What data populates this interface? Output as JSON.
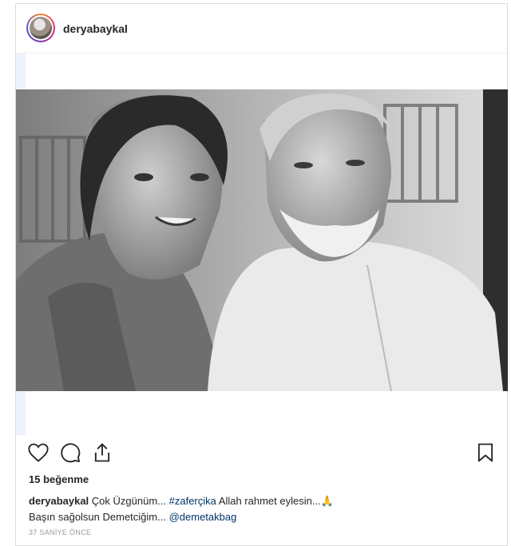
{
  "post": {
    "username": "deryabaykal",
    "likes": "15 beğenme",
    "caption": {
      "user": "deryabaykal",
      "text1": "Çok Üzgünüm...",
      "hashtag": "#zaferçika",
      "text2": "Allah rahmet eylesin...",
      "emoji": "🙏",
      "line2": "Başın sağolsun Demetciğim...",
      "mention": "@demetakbag"
    },
    "timestamp": "37 SANİYE ÖNCE",
    "image": {
      "description": "black-and-white photo of a smiling woman and a white-bearded man"
    }
  },
  "icons": {
    "like": "heart-icon",
    "comment": "comment-bubble-icon",
    "share": "share-icon",
    "save": "bookmark-icon"
  }
}
